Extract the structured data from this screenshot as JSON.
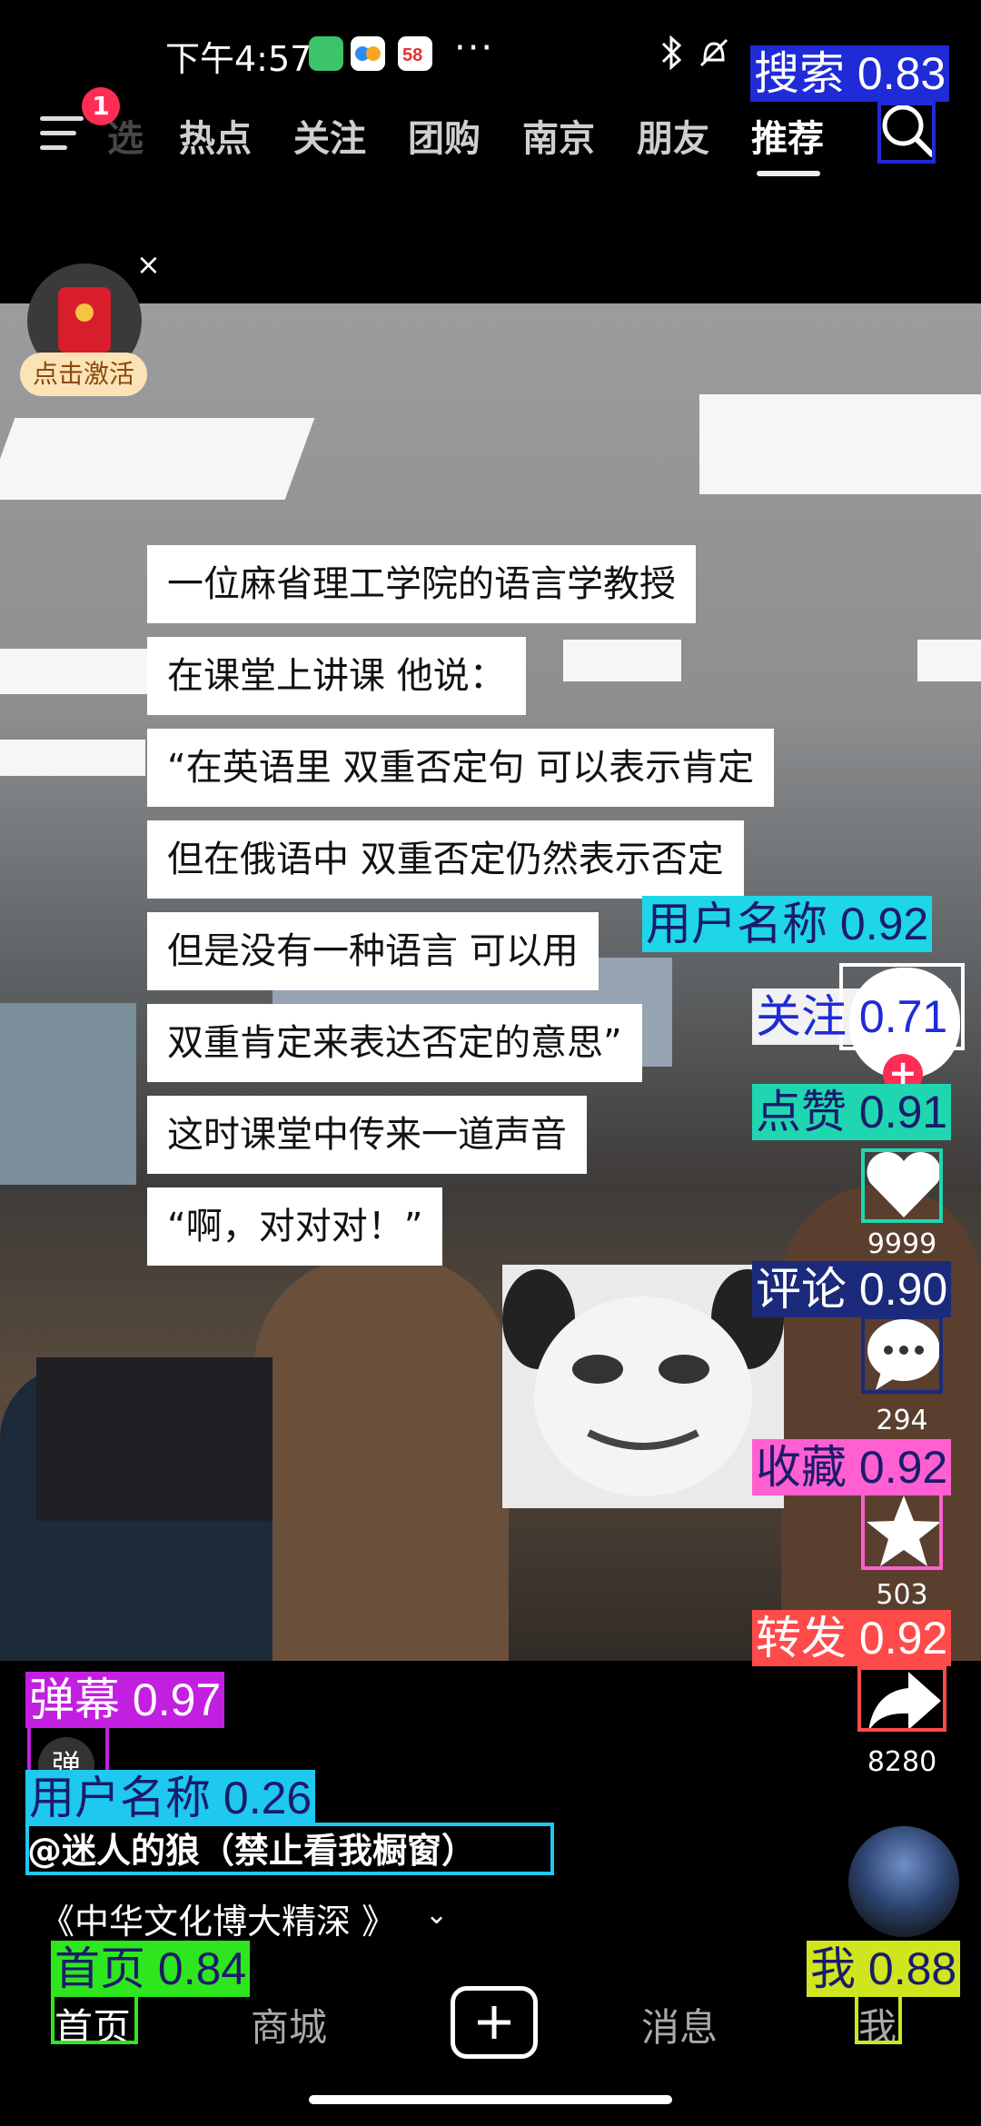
{
  "status_bar": {
    "time": "下午4:57",
    "dots": "···"
  },
  "nav": {
    "badge": "1",
    "partial_tab": "选",
    "tabs": [
      "热点",
      "关注",
      "团购",
      "南京",
      "朋友",
      "推荐"
    ],
    "active_tab": "推荐"
  },
  "activate": {
    "label": "点击激活",
    "close": "×"
  },
  "captions": [
    "一位麻省理工学院的语言学教授",
    "在课堂上讲课 他说：",
    "“在英语里 双重否定句 可以表示肯定",
    "但在俄语中 双重否定仍然表示否定",
    "但是没有一种语言 可以用",
    "双重肯定来表达否定的意思”",
    "这时课堂中传来一道声音",
    "“啊，对对对！”"
  ],
  "rail": {
    "like_count": "9999",
    "comment_count": "294",
    "favorite_count": "503",
    "share_count": "8280",
    "follow_plus": "+"
  },
  "info": {
    "danmu_icon": "弹",
    "username": "@迷人的狼（禁止看我橱窗）",
    "title": "《中华文化博大精深 》",
    "chevron": "⌄"
  },
  "bottom_nav": {
    "home": "首页",
    "mall": "商城",
    "messages": "消息",
    "me": "我"
  },
  "detections": [
    {
      "label": "搜索 0.83",
      "color": "#1f2bd6",
      "text_color": "#ffffff"
    },
    {
      "label": "用户名称 0.92",
      "color": "#1ed6e6",
      "text_color": "#1b1b6b"
    },
    {
      "label": "关注 0.71",
      "color": "#ffffff",
      "text_color": "#1f2bd6"
    },
    {
      "label": "点赞 0.91",
      "color": "#1fd6b0",
      "text_color": "#1b1b6b"
    },
    {
      "label": "评论 0.90",
      "color": "#1b2a7a",
      "text_color": "#ffffff"
    },
    {
      "label": "收藏 0.92",
      "color": "#ff5fd0",
      "text_color": "#1b1b6b"
    },
    {
      "label": "转发 0.92",
      "color": "#ff4a4a",
      "text_color": "#ffffff"
    },
    {
      "label": "弹幕 0.97",
      "color": "#c21fe0",
      "text_color": "#ffffff"
    },
    {
      "label": "用户名称 0.26",
      "color": "#1ec8ef",
      "text_color": "#1b1b6b"
    },
    {
      "label": "首页 0.84",
      "color": "#2ee61e",
      "text_color": "#1b1b6b"
    },
    {
      "label": "我 0.88",
      "color": "#cfe61e",
      "text_color": "#1b1b6b"
    }
  ]
}
